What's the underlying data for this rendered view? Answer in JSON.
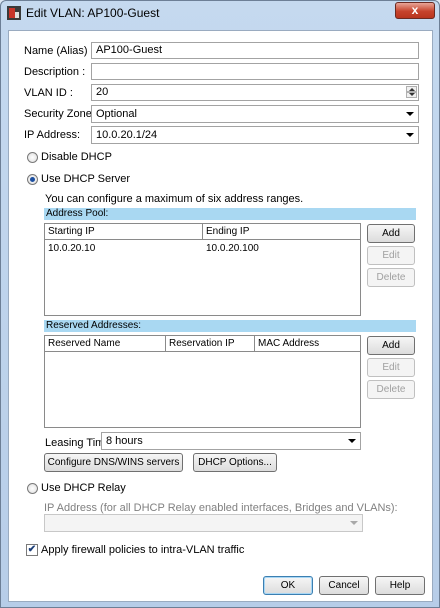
{
  "window": {
    "title": "Edit VLAN: AP100-Guest",
    "close_glyph": "x"
  },
  "form": {
    "name_label": "Name (Alias) :",
    "name_value": "AP100-Guest",
    "description_label": "Description :",
    "description_value": "",
    "vlan_id_label": "VLAN ID :",
    "vlan_id_value": "20",
    "security_zone_label": "Security Zone :",
    "security_zone_value": "Optional",
    "ip_address_label": "IP Address:",
    "ip_address_value": "10.0.20.1/24"
  },
  "dhcp": {
    "disable_label": "Disable DHCP",
    "use_server_label": "Use DHCP Server",
    "selected": "use_server",
    "max_ranges_note": "You can configure a maximum of six address ranges.",
    "address_pool": {
      "title": "Address Pool:",
      "columns": [
        "Starting IP",
        "Ending IP"
      ],
      "rows": [
        [
          "10.0.20.10",
          "10.0.20.100"
        ]
      ],
      "buttons": {
        "add": "Add",
        "edit": "Edit",
        "delete": "Delete"
      }
    },
    "reserved": {
      "title": "Reserved Addresses:",
      "columns": [
        "Reserved Name",
        "Reservation IP",
        "MAC Address"
      ],
      "rows": [],
      "buttons": {
        "add": "Add",
        "edit": "Edit",
        "delete": "Delete"
      }
    },
    "leasing_time_label": "Leasing Time",
    "leasing_time_value": "8 hours",
    "configure_dns_button": "Configure DNS/WINS servers",
    "dhcp_options_button": "DHCP Options...",
    "relay_label": "Use DHCP Relay",
    "relay_ip_label": "IP Address (for all DHCP Relay enabled interfaces, Bridges and VLANs):",
    "relay_ip_value": ""
  },
  "firewall": {
    "label": "Apply firewall policies to intra-VLAN traffic",
    "checked": true,
    "check_glyph": "✔"
  },
  "footer": {
    "ok": "OK",
    "cancel": "Cancel",
    "help": "Help"
  },
  "colors": {
    "section_bar": "#a9d8f2",
    "window_frame": "#b7cde8",
    "close_button": "#c7432c"
  }
}
